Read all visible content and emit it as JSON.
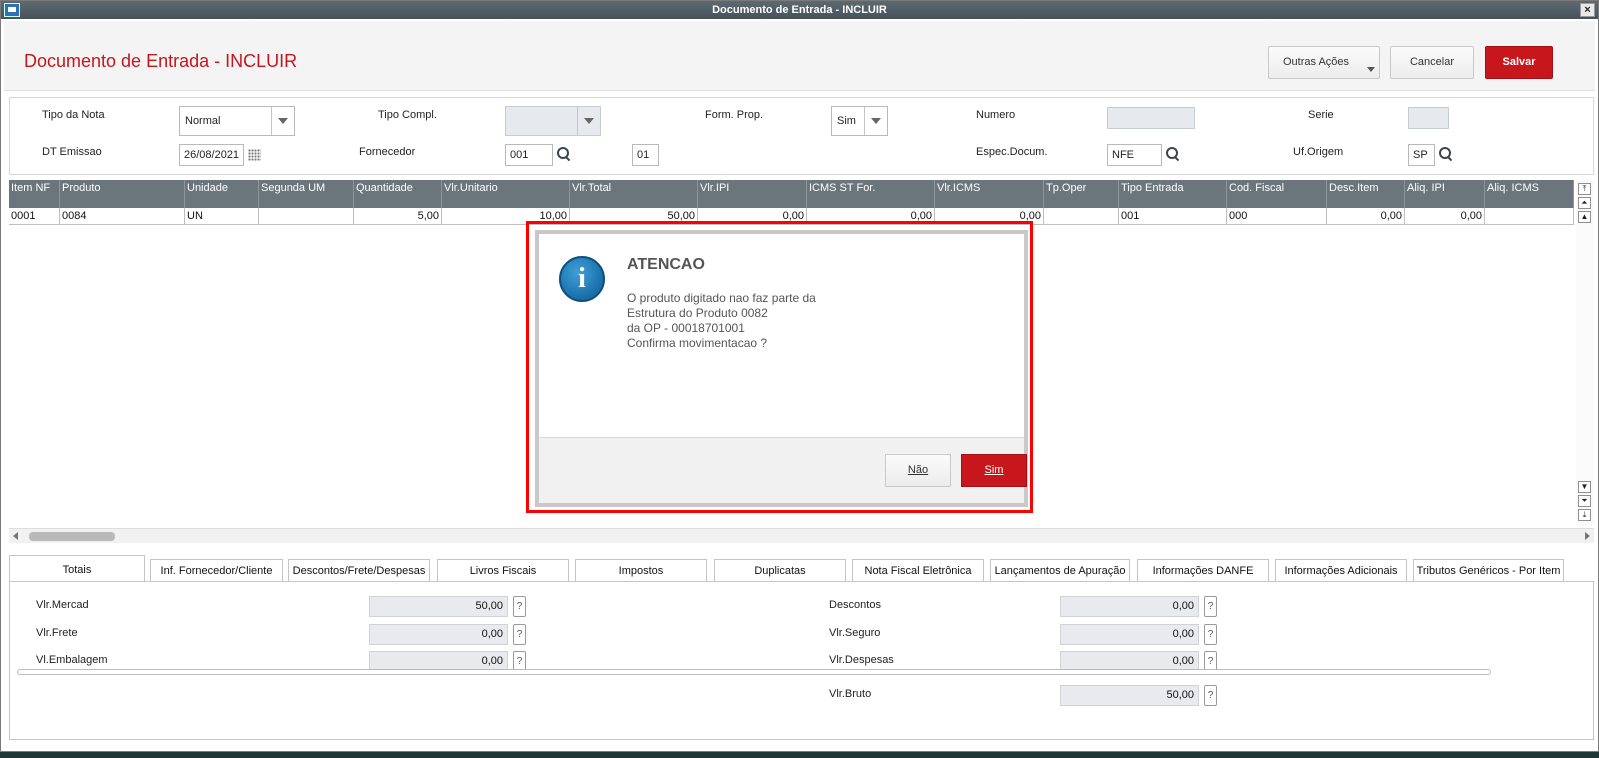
{
  "window": {
    "title": "Documento de Entrada - INCLUIR",
    "close_label": "×"
  },
  "header": {
    "title": "Documento de Entrada - INCLUIR",
    "other_actions_label": "Outras Ações",
    "cancel_label": "Cancelar",
    "save_label": "Salvar"
  },
  "form": {
    "tipo_nota": {
      "label": "Tipo da Nota",
      "value": "Normal"
    },
    "tipo_compl": {
      "label": "Tipo Compl.",
      "value": ""
    },
    "form_prop": {
      "label": "Form. Prop.",
      "value": "Sim"
    },
    "numero": {
      "label": "Numero",
      "value": ""
    },
    "serie": {
      "label": "Serie",
      "value": ""
    },
    "dt_emissao": {
      "label": "DT Emissao",
      "value": "26/08/2021"
    },
    "fornecedor": {
      "label": "Fornecedor",
      "value": "001",
      "loja": "01"
    },
    "espec_docum": {
      "label": "Espec.Docum.",
      "value": "NFE"
    },
    "uf_origem": {
      "label": "Uf.Origem",
      "value": "SP"
    }
  },
  "grid": {
    "columns": [
      "Item NF",
      "Produto",
      "Unidade",
      "Segunda UM",
      "Quantidade",
      "Vlr.Unitario",
      "Vlr.Total",
      "Vlr.IPI",
      "ICMS ST For.",
      "Vlr.ICMS",
      "Tp.Oper",
      "Tipo Entrada",
      "Cod. Fiscal",
      "Desc.Item",
      "Aliq. IPI",
      "Aliq. ICMS"
    ],
    "rows": [
      [
        "0001",
        "0084",
        "UN",
        "",
        "5,00",
        "10,00",
        "50,00",
        "0,00",
        "0,00",
        "0,00",
        "",
        "001",
        "000",
        "0,00",
        "0,00",
        ""
      ]
    ]
  },
  "tabs": [
    "Totais",
    "Inf. Fornecedor/Cliente",
    "Descontos/Frete/Despesas",
    "Livros Fiscais",
    "Impostos",
    "Duplicatas",
    "Nota Fiscal Eletrônica",
    "Lançamentos de Apuração",
    "Informações DANFE",
    "Informações Adicionais",
    "Tributos Genéricos - Por Item"
  ],
  "totais": {
    "vlr_mercad": {
      "label": "Vlr.Mercad",
      "value": "50,00"
    },
    "vlr_frete": {
      "label": "Vlr.Frete",
      "value": "0,00"
    },
    "vl_embalagem": {
      "label": "Vl.Embalagem",
      "value": "0,00"
    },
    "descontos": {
      "label": "Descontos",
      "value": "0,00"
    },
    "vlr_seguro": {
      "label": "Vlr.Seguro",
      "value": "0,00"
    },
    "vlr_despesas": {
      "label": "Vlr.Despesas",
      "value": "0,00"
    },
    "vlr_bruto": {
      "label": "Vlr.Bruto",
      "value": "50,00"
    },
    "help_label": "?"
  },
  "dialog": {
    "title": "ATENCAO",
    "icon": "info-icon",
    "message": "O produto digitado nao faz parte da\nEstrutura do Produto 0082\nda OP - 00018701001\nConfirma movimentacao ?",
    "no_label": "Não",
    "yes_label": "Sim"
  },
  "colors": {
    "accent_red": "#c8161d",
    "grid_header": "#6b757c",
    "highlight_frame": "#ff0000"
  }
}
